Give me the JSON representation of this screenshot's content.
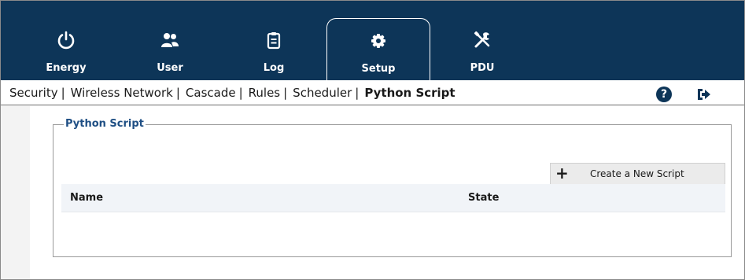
{
  "nav": {
    "tabs": [
      {
        "label": "Energy",
        "icon": "power-icon"
      },
      {
        "label": "User",
        "icon": "users-icon"
      },
      {
        "label": "Log",
        "icon": "clipboard-icon"
      },
      {
        "label": "Setup",
        "icon": "gear-icon",
        "active": true
      },
      {
        "label": "PDU",
        "icon": "tools-icon"
      }
    ]
  },
  "subnav": {
    "links": [
      "Security",
      "Wireless Network",
      "Cascade",
      "Rules",
      "Scheduler",
      "Python Script"
    ],
    "separator": "|",
    "current": "Python Script",
    "help_glyph": "?"
  },
  "panel": {
    "legend": "Python Script",
    "create_button": {
      "icon": "plus-icon",
      "plus_glyph": "+",
      "label": "Create a New Script"
    },
    "table": {
      "columns": [
        "Name",
        "State"
      ],
      "rows": []
    }
  },
  "colors": {
    "navy": "#0d3558",
    "legend_blue": "#1f4f84"
  }
}
